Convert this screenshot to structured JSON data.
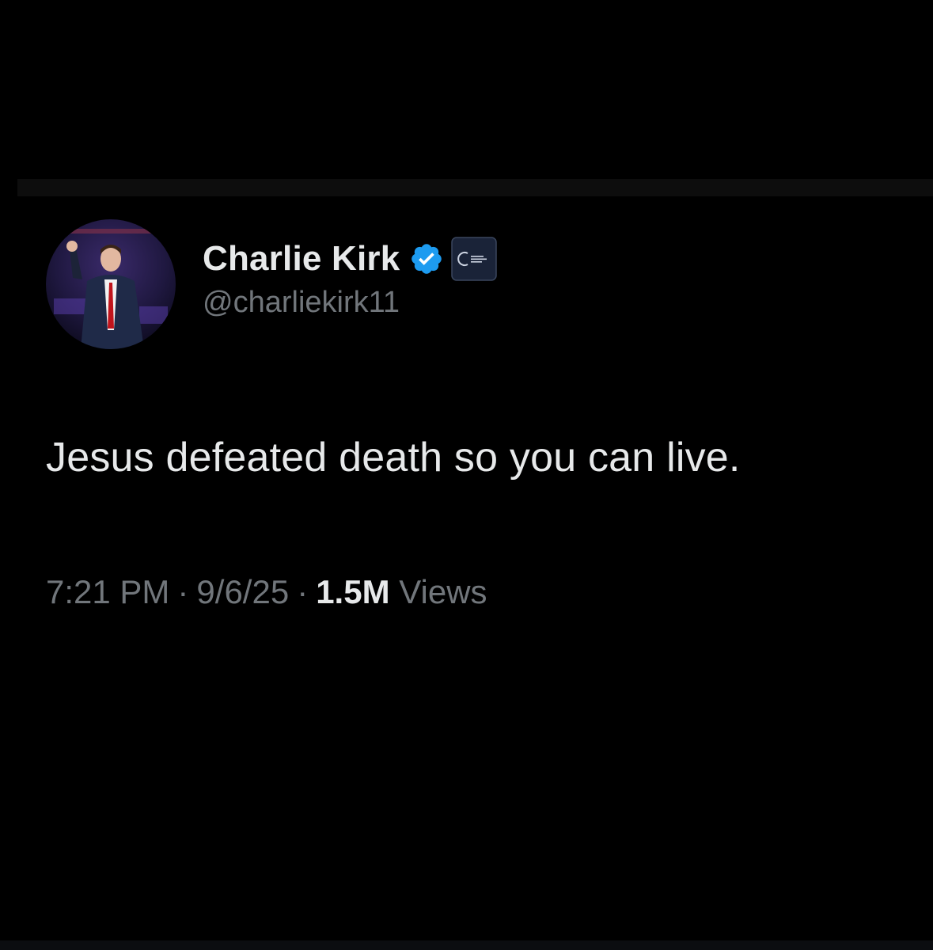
{
  "tweet": {
    "author": {
      "display_name": "Charlie Kirk",
      "handle": "@charliekirk11",
      "verified": true,
      "verified_icon": "verified-check-icon",
      "affiliate_icon": "organization-affiliate-badge"
    },
    "text": "Jesus defeated death so you can live.",
    "meta": {
      "time": "7:21 PM",
      "date": "9/6/25",
      "separator": "·",
      "views_count": "1.5M",
      "views_label": "Views"
    }
  },
  "colors": {
    "background": "#000000",
    "primary_text": "#e7e9ea",
    "secondary_text": "#71767b",
    "verified_blue": "#1d9bf0"
  }
}
